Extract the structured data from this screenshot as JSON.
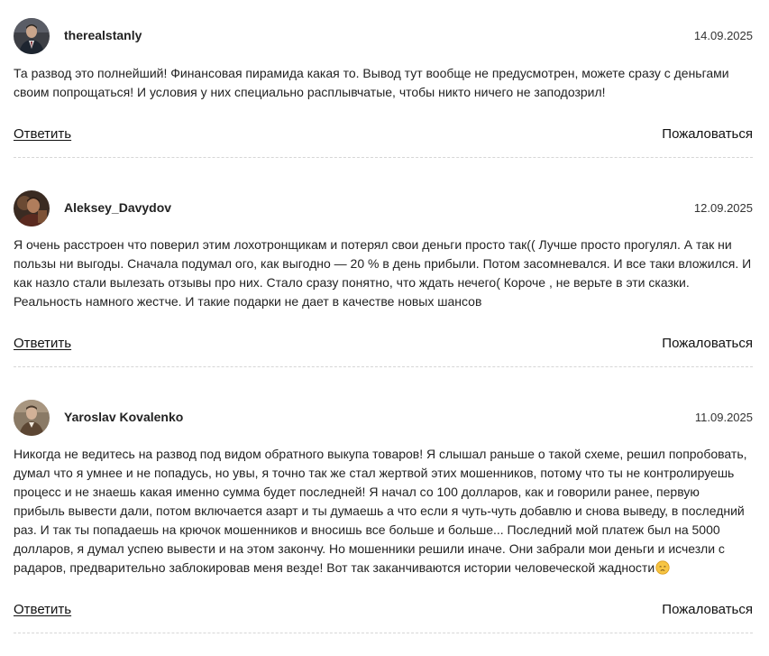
{
  "comments": [
    {
      "username": "therealstanly",
      "date": "14.09.2025",
      "avatar_icon": "user-avatar-photo",
      "text": "Та развод это полнейший! Финансовая пирамида какая то. Вывод тут вообще не предусмотрен, можете сразу с деньгами своим попрощаться! И условия у них специально расплывчатые, чтобы никто ничего не заподозрил!",
      "reply_label": "Ответить",
      "report_label": "Пожаловаться"
    },
    {
      "username": "Aleksey_Davydov",
      "date": "12.09.2025",
      "avatar_icon": "user-avatar-photo",
      "text": "Я очень расстроен что поверил этим лохотронщикам и потерял свои деньги просто так(( Лучше просто прогулял. А так ни пользы ни выгоды. Сначала подумал ого, как выгодно — 20 % в день прибыли. Потом засомневался. И все таки вложился. И как назло стали вылезать отзывы про них. Стало сразу понятно, что ждать нечего( Короче , не верьте в эти сказки. Реальность намного жестче. И такие подарки не дает в качестве новых шансов",
      "reply_label": "Ответить",
      "report_label": "Пожаловаться"
    },
    {
      "username": "Yaroslav Kovalenko",
      "date": "11.09.2025",
      "avatar_icon": "user-avatar-photo",
      "text": "Никогда не ведитесь на развод под видом обратного выкупа товаров! Я слышал раньше о такой схеме, решил попробовать, думал что я умнее и не попадусь, но увы, я точно так же стал жертвой этих мошенников, потому что ты не контролируешь процесс и не знаешь какая именно сумма будет последней! Я начал со 100 долларов, как и говорили ранее, первую прибыль вывести дали, потом включается азарт и ты думаешь а что если я чуть-чуть добавлю и снова выведу, в последний раз. И так ты попадаешь на крючок мошенников и вносишь все больше и больше... Последний мой платеж был на 5000 долларов, я думал успею вывести и на этом закончу. Но мошенники решили иначе. Они забрали мои деньги и исчезли с радаров, предварительно заблокировав меня везде! Вот так заканчиваются истории человеческой жадности",
      "trailing_emoji": "disappointed-face-emoji",
      "reply_label": "Ответить",
      "report_label": "Пожаловаться"
    }
  ]
}
